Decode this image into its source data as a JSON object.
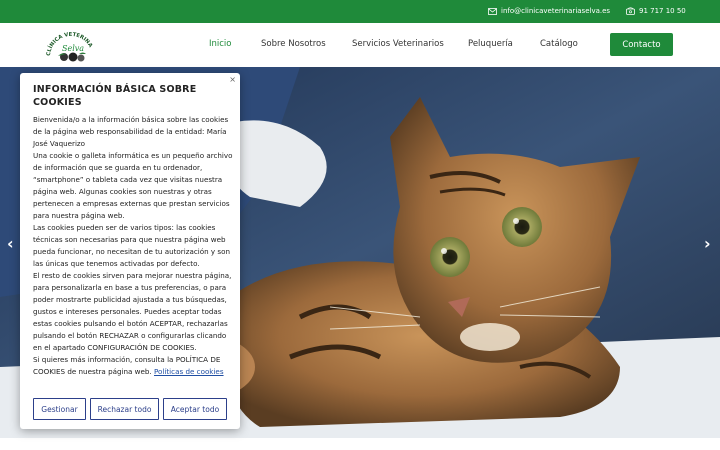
{
  "topbar": {
    "email": "info@clinicaveterinariaselva.es",
    "phone": "91 717 10 50"
  },
  "logo": {
    "text": "CLÍNICA VETERINARIA",
    "script": "Selva"
  },
  "nav": {
    "items": [
      {
        "label": "Inicio",
        "active": true
      },
      {
        "label": "Sobre Nosotros",
        "active": false
      },
      {
        "label": "Servicios Veterinarios",
        "active": false
      },
      {
        "label": "Peluquería",
        "active": false
      },
      {
        "label": "Catálogo",
        "active": false
      }
    ],
    "contact_label": "Contacto"
  },
  "hero": {
    "prev_arrow": "‹",
    "next_arrow": "›"
  },
  "cookie": {
    "close": "×",
    "title": "INFORMACIÓN BÁSICA SOBRE COOKIES",
    "p1": "Bienvenida/o a la información básica sobre las cookies de la página web responsabilidad de la entidad: María José Vaquerizo",
    "p2": "Una cookie o galleta informática es un pequeño archivo de información que se guarda en tu ordenador, “smartphone” o tableta cada vez que visitas nuestra página web. Algunas cookies son nuestras y otras pertenecen a empresas externas que prestan servicios para nuestra página web.",
    "p3": "Las cookies pueden ser de varios tipos: las cookies técnicas son necesarias para que nuestra página web pueda funcionar, no necesitan de tu autorización y son las únicas que tenemos activadas por defecto.",
    "p4": "El resto de cookies sirven para mejorar nuestra página, para personalizarla en base a tus preferencias, o para poder mostrarte publicidad ajustada a tus búsquedas, gustos e intereses personales. Puedes aceptar todas estas cookies pulsando el botón ACEPTAR, rechazarlas pulsando el botón RECHAZAR o configurarlas clicando en el apartado CONFIGURACIÓN DE COOKIES.",
    "p5": "Si quieres más información, consulta la POLÍTICA DE COOKIES de nuestra página web.",
    "policy_link": "Políticas de cookies",
    "buttons": {
      "manage": "Gestionar",
      "reject": "Rechazar todo",
      "accept": "Aceptar todo"
    }
  },
  "colors": {
    "brand_green": "#1f8a3a",
    "button_border": "#2c3f8a"
  }
}
